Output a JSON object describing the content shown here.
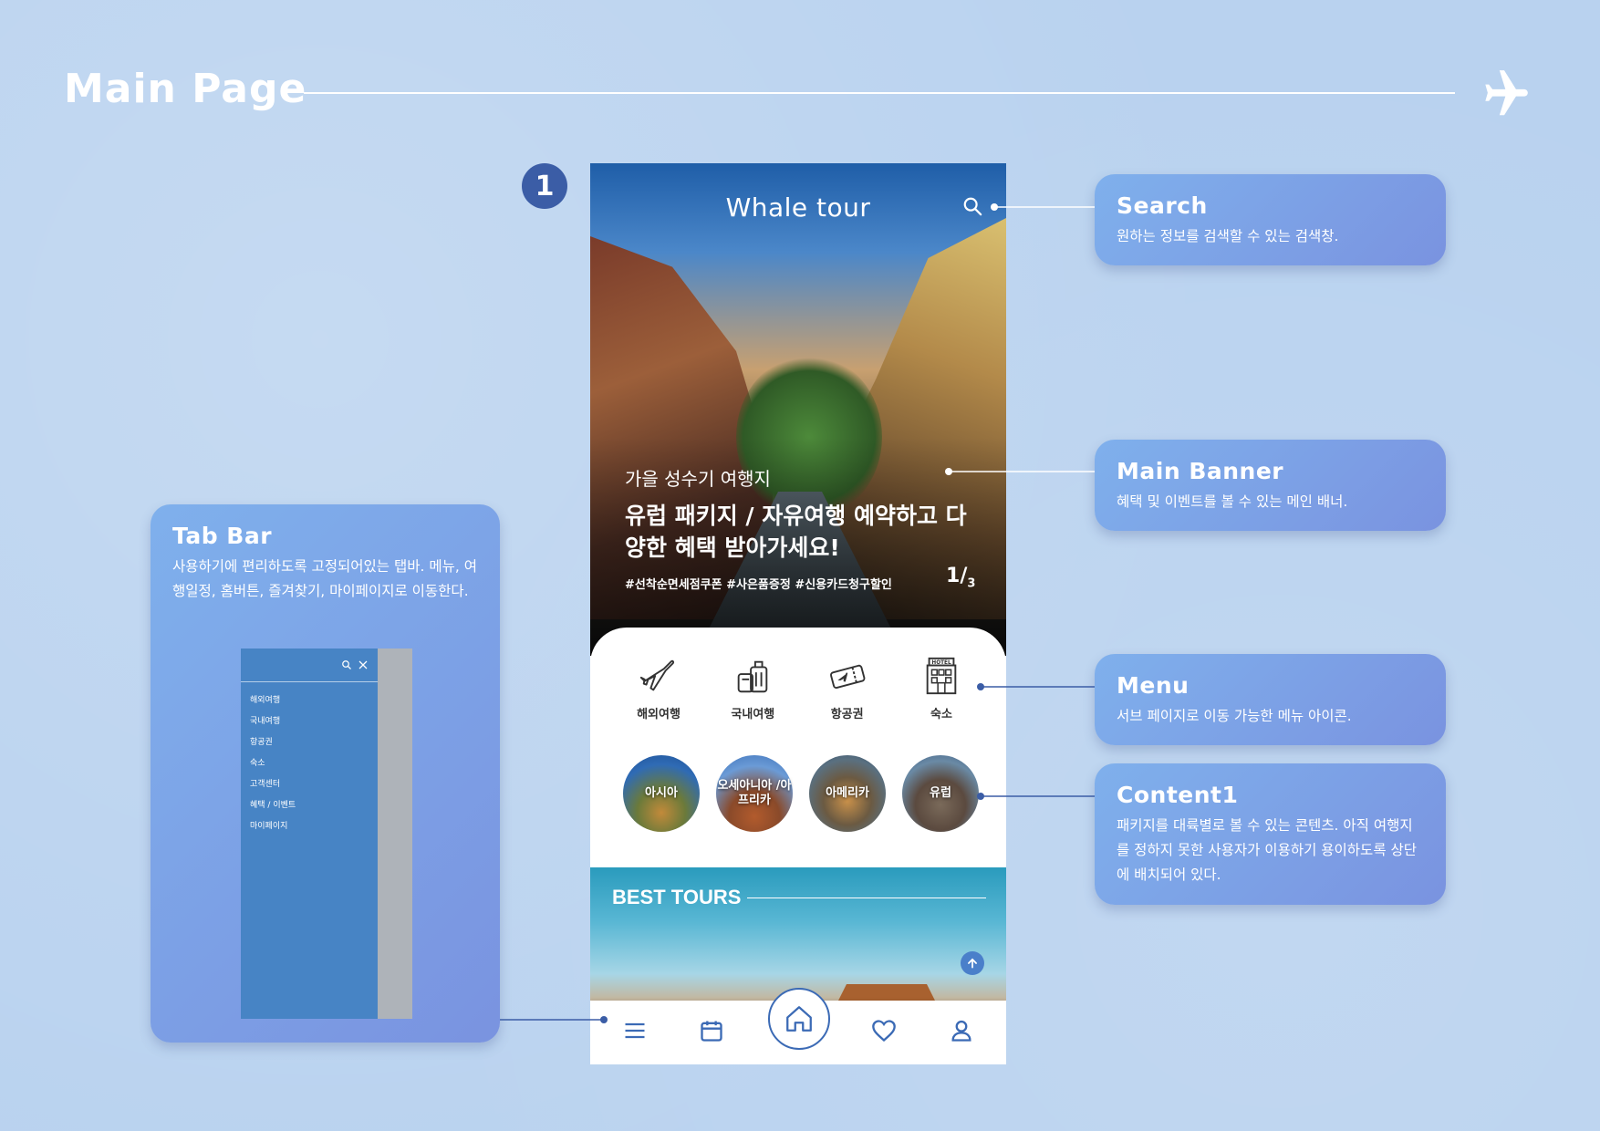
{
  "page": {
    "title": "Main Page",
    "step": "1"
  },
  "app": {
    "logo": "Whale tour",
    "banner": {
      "subtitle": "가을 성수기 여행지",
      "headline": "유럽 패키지 / 자유여행 예약하고 다양한 혜택 받아가세요!",
      "tags": "#선착순면세점쿠폰  #사은품증정  #신용카드청구할인",
      "page_current": "1",
      "page_total": "3"
    },
    "menu": [
      {
        "label": "해외여행",
        "icon": "airplane-icon"
      },
      {
        "label": "국내여행",
        "icon": "luggage-icon"
      },
      {
        "label": "항공권",
        "icon": "ticket-icon"
      },
      {
        "label": "숙소",
        "icon": "hotel-icon"
      }
    ],
    "regions": [
      {
        "label": "아시아"
      },
      {
        "label": "오세아니아 /아프리카"
      },
      {
        "label": "아메리카"
      },
      {
        "label": "유럽"
      }
    ],
    "best_tours": {
      "title": "BEST TOURS"
    },
    "tab_bar": [
      "menu-icon",
      "calendar-icon",
      "home-icon",
      "heart-icon",
      "user-icon"
    ],
    "sidebar": {
      "items": [
        "해외여행",
        "국내여행",
        "항공권",
        "숙소",
        "고객센터",
        "혜택 / 이벤트",
        "마이페이지"
      ]
    }
  },
  "callouts": {
    "search": {
      "title": "Search",
      "desc": "원하는 정보를 검색할 수 있는 검색창."
    },
    "main_banner": {
      "title": "Main Banner",
      "desc": "혜택 및 이벤트를 볼 수 있는 메인 배너."
    },
    "menu": {
      "title": "Menu",
      "desc": "서브 페이지로 이동 가능한 메뉴 아이콘."
    },
    "content1": {
      "title": "Content1",
      "desc": "패키지를 대륙별로 볼 수 있는 콘텐츠. 아직 여행지를 정하지 못한 사용자가 이용하기 용이하도록 상단에 배치되어 있다."
    },
    "tab_bar": {
      "title": "Tab Bar",
      "desc": "사용하기에 편리하도록 고정되어있는 탭바. 메뉴, 여행일정, 홈버튼, 즐겨찾기, 마이페이지로 이동한다."
    }
  },
  "colors": {
    "accent": "#3b6ab5",
    "background": "#b9d2ef",
    "callout": "#7a93e0"
  }
}
